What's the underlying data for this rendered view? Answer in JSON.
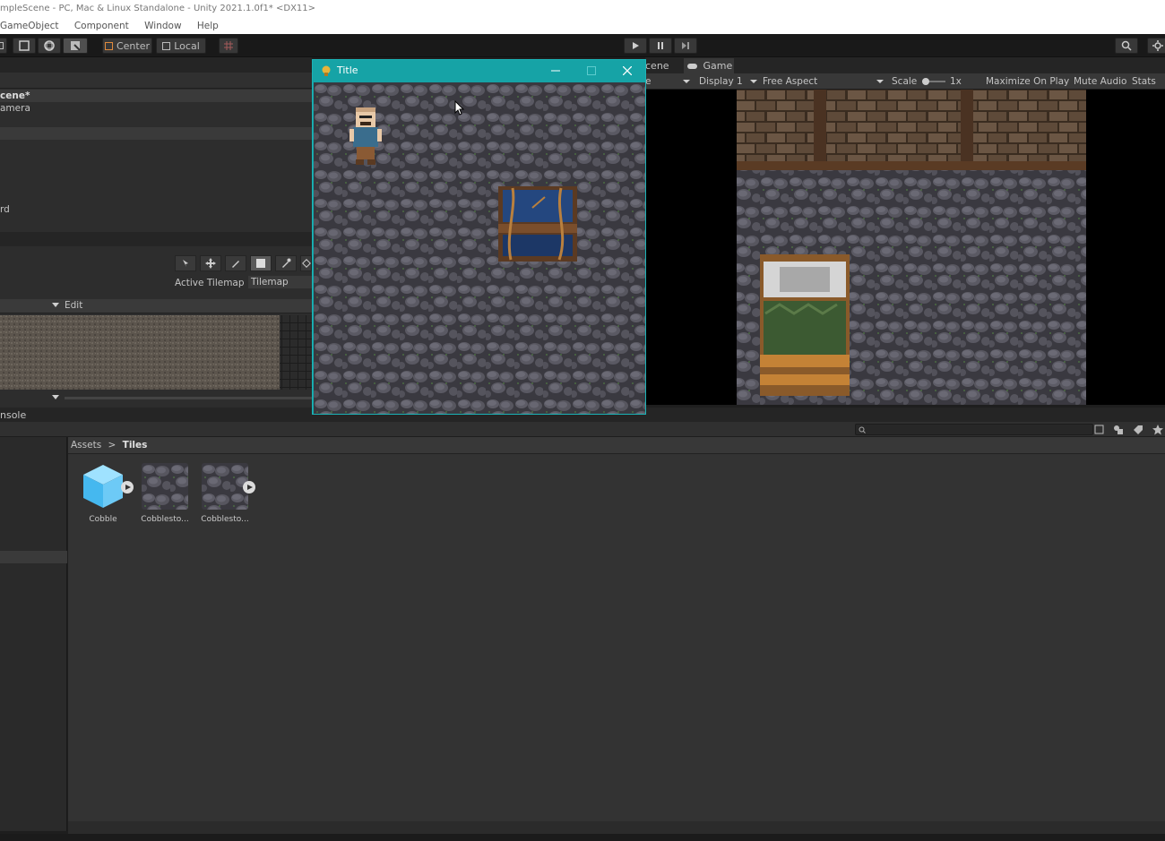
{
  "window_title": "mpleScene - PC, Mac & Linux Standalone - Unity 2021.1.0f1* <DX11>",
  "menu": [
    "GameObject",
    "Component",
    "Window",
    "Help"
  ],
  "toolbar": {
    "pivot_center": "Center",
    "pivot_local": "Local"
  },
  "hierarchy": {
    "scene_row": "cene*",
    "camera_row": "amera",
    "grid_row": "rd"
  },
  "tile_palette": {
    "active_tilemap_label": "Active Tilemap",
    "active_tilemap_value": "Tilemap",
    "edit_label": "Edit"
  },
  "console_tab": "nsole",
  "scene_tab": "cene",
  "game_tab": "Game",
  "game_toolbar": {
    "display": "Display 1",
    "aspect": "Free Aspect",
    "scale_label": "Scale",
    "scale_value": "1x",
    "maximize": "Maximize On Play",
    "mute": "Mute Audio",
    "stats": "Stats",
    "left_cut": "e"
  },
  "project": {
    "breadcrumb_root": "Assets",
    "breadcrumb_sep": ">",
    "breadcrumb_leaf": "Tiles",
    "assets": [
      {
        "name": "Cobble",
        "icon": "cube-icon"
      },
      {
        "name": "Cobblesto...",
        "icon": "tile-thumbnail"
      },
      {
        "name": "Cobblesto...",
        "icon": "tile-thumbnail"
      }
    ]
  },
  "popup": {
    "title": "Title"
  }
}
